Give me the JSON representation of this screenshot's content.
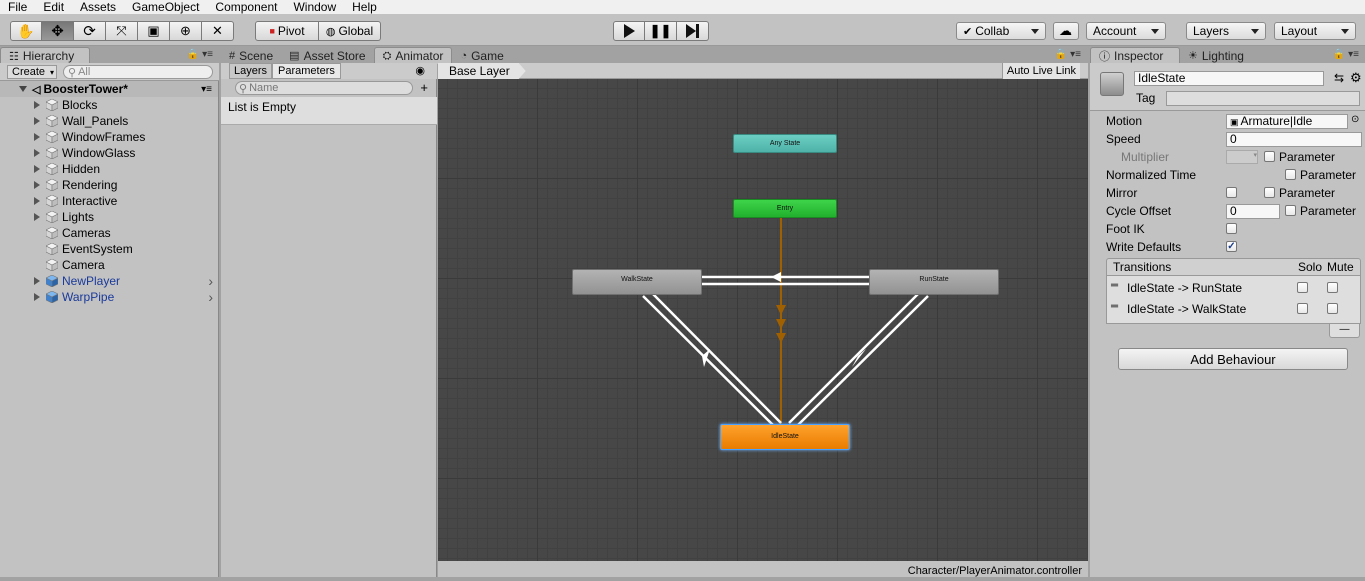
{
  "menu": [
    "File",
    "Edit",
    "Assets",
    "GameObject",
    "Component",
    "Window",
    "Help"
  ],
  "toolbar": {
    "tools": [
      "hand-tool",
      "move-tool",
      "rotate-tool",
      "scale-tool",
      "rect-tool",
      "transform-tool",
      "custom-tool"
    ],
    "active_tool": "move-tool",
    "pivot_label": "Pivot",
    "global_label": "Global",
    "collab_label": "Collab",
    "account_label": "Account",
    "layers_label": "Layers",
    "layout_label": "Layout"
  },
  "hierarchy": {
    "tab_label": "Hierarchy",
    "create_label": "Create",
    "search_placeholder": "All",
    "scene_name": "BoosterTower*",
    "items": [
      {
        "label": "Blocks",
        "expandable": true,
        "prefab": false
      },
      {
        "label": "Wall_Panels",
        "expandable": true,
        "prefab": false
      },
      {
        "label": "WindowFrames",
        "expandable": true,
        "prefab": false
      },
      {
        "label": "WindowGlass",
        "expandable": true,
        "prefab": false
      },
      {
        "label": "Hidden",
        "expandable": true,
        "prefab": false
      },
      {
        "label": "Rendering",
        "expandable": true,
        "prefab": false
      },
      {
        "label": "Interactive",
        "expandable": true,
        "prefab": false
      },
      {
        "label": "Lights",
        "expandable": true,
        "prefab": false
      },
      {
        "label": "Cameras",
        "expandable": false,
        "prefab": false
      },
      {
        "label": "EventSystem",
        "expandable": false,
        "prefab": false
      },
      {
        "label": "Camera",
        "expandable": false,
        "prefab": false
      },
      {
        "label": "NewPlayer",
        "expandable": true,
        "prefab": true
      },
      {
        "label": "WarpPipe",
        "expandable": true,
        "prefab": true
      }
    ]
  },
  "center_tabs": [
    {
      "label": "Scene",
      "icon": "grid-icon"
    },
    {
      "label": "Asset Store",
      "icon": "store-icon"
    },
    {
      "label": "Animator",
      "icon": "animator-icon",
      "active": true
    },
    {
      "label": "Game",
      "icon": "pacman-icon"
    }
  ],
  "animator": {
    "sub_tabs": [
      "Layers",
      "Parameters"
    ],
    "active_sub_tab": "Parameters",
    "name_placeholder": "Name",
    "list_empty_text": "List is Empty",
    "breadcrumb": "Base Layer",
    "auto_live_link": "Auto Live Link",
    "footer_path": "Character/PlayerAnimator.controller",
    "states": [
      {
        "name": "Any State",
        "color": "#5ebcb3"
      },
      {
        "name": "Entry",
        "color": "#2fc43a"
      },
      {
        "name": "WalkState",
        "color": "#9e9e9e"
      },
      {
        "name": "RunState",
        "color": "#9e9e9e"
      },
      {
        "name": "IdleState",
        "color": "#f08a10",
        "selected": true
      }
    ],
    "transitions": [
      {
        "from": "Entry",
        "to": "IdleState",
        "type": "default"
      },
      {
        "from": "WalkState",
        "to": "RunState"
      },
      {
        "from": "RunState",
        "to": "WalkState"
      },
      {
        "from": "WalkState",
        "to": "IdleState"
      },
      {
        "from": "IdleState",
        "to": "WalkState"
      },
      {
        "from": "RunState",
        "to": "IdleState"
      },
      {
        "from": "IdleState",
        "to": "RunState"
      }
    ]
  },
  "inspector": {
    "tabs": [
      "Inspector",
      "Lighting"
    ],
    "object_name": "IdleState",
    "tag_label": "Tag",
    "tag_value": "",
    "motion_label": "Motion",
    "motion_value": "Armature|Idle",
    "speed_label": "Speed",
    "speed_value": "0",
    "multiplier_label": "Multiplier",
    "normalized_time_label": "Normalized Time",
    "mirror_label": "Mirror",
    "cycle_offset_label": "Cycle Offset",
    "cycle_offset_value": "0",
    "foot_ik_label": "Foot IK",
    "write_defaults_label": "Write Defaults",
    "write_defaults_checked": true,
    "parameter_label": "Parameter",
    "transitions_header": "Transitions",
    "solo_label": "Solo",
    "mute_label": "Mute",
    "transitions": [
      "IdleState -> RunState",
      "IdleState -> WalkState"
    ],
    "add_behaviour_label": "Add Behaviour"
  }
}
